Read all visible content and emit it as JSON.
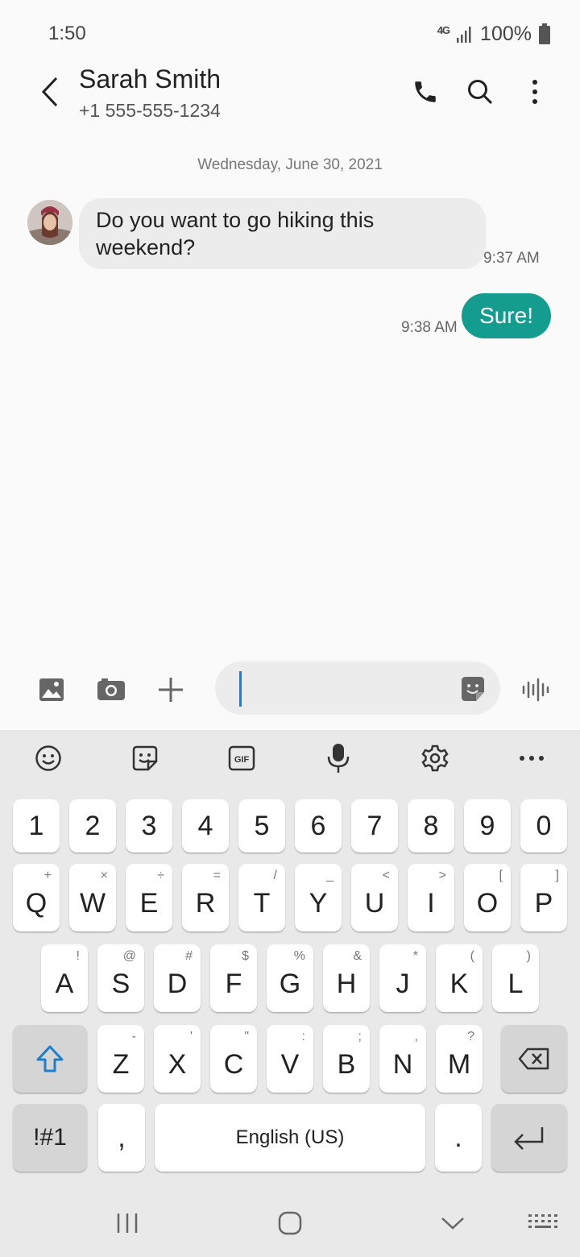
{
  "status_bar": {
    "time": "1:50",
    "network": "4G",
    "battery": "100%"
  },
  "header": {
    "contact_name": "Sarah Smith",
    "contact_number": "+1 555-555-1234",
    "icons": [
      "back-arrow-icon",
      "phone-icon",
      "search-icon",
      "more-vert-icon"
    ]
  },
  "conversation": {
    "date_label": "Wednesday, June 30, 2021",
    "messages": [
      {
        "direction": "incoming",
        "text": "Do you want to go hiking this weekend?",
        "time": "9:37 AM"
      },
      {
        "direction": "outgoing",
        "text": "Sure!",
        "time": "9:38 AM"
      }
    ]
  },
  "composer": {
    "value": "",
    "placeholder": "",
    "icons": [
      "gallery-icon",
      "camera-icon",
      "plus-icon",
      "sticker-icon",
      "voice-wave-icon"
    ]
  },
  "keyboard": {
    "toolbar": [
      "emoji-icon",
      "sticker-icon",
      "gif-icon",
      "mic-icon",
      "settings-icon",
      "more-horiz-icon"
    ],
    "number_row": [
      "1",
      "2",
      "3",
      "4",
      "5",
      "6",
      "7",
      "8",
      "9",
      "0"
    ],
    "row1": [
      {
        "k": "Q",
        "h": "+"
      },
      {
        "k": "W",
        "h": "×"
      },
      {
        "k": "E",
        "h": "÷"
      },
      {
        "k": "R",
        "h": "="
      },
      {
        "k": "T",
        "h": "/"
      },
      {
        "k": "Y",
        "h": "_"
      },
      {
        "k": "U",
        "h": "<"
      },
      {
        "k": "I",
        "h": ">"
      },
      {
        "k": "O",
        "h": "["
      },
      {
        "k": "P",
        "h": "]"
      }
    ],
    "row2": [
      {
        "k": "A",
        "h": "!"
      },
      {
        "k": "S",
        "h": "@"
      },
      {
        "k": "D",
        "h": "#"
      },
      {
        "k": "F",
        "h": "$"
      },
      {
        "k": "G",
        "h": "%"
      },
      {
        "k": "H",
        "h": "&"
      },
      {
        "k": "J",
        "h": "*"
      },
      {
        "k": "K",
        "h": "("
      },
      {
        "k": "L",
        "h": ")"
      }
    ],
    "row3": [
      {
        "k": "Z",
        "h": "-"
      },
      {
        "k": "X",
        "h": "'"
      },
      {
        "k": "C",
        "h": "\""
      },
      {
        "k": "V",
        "h": ":"
      },
      {
        "k": "B",
        "h": ";"
      },
      {
        "k": "N",
        "h": ","
      },
      {
        "k": "M",
        "h": "?"
      }
    ],
    "symbols_label": "!#1",
    "comma": ",",
    "space_label": "English (US)",
    "period": "."
  },
  "nav_bar": {
    "icons": [
      "recents-icon",
      "home-icon",
      "back-chevron-icon",
      "keyboard-switch-icon"
    ]
  },
  "colors": {
    "accent": "#149c8f",
    "cursor": "#1a7fd0"
  }
}
